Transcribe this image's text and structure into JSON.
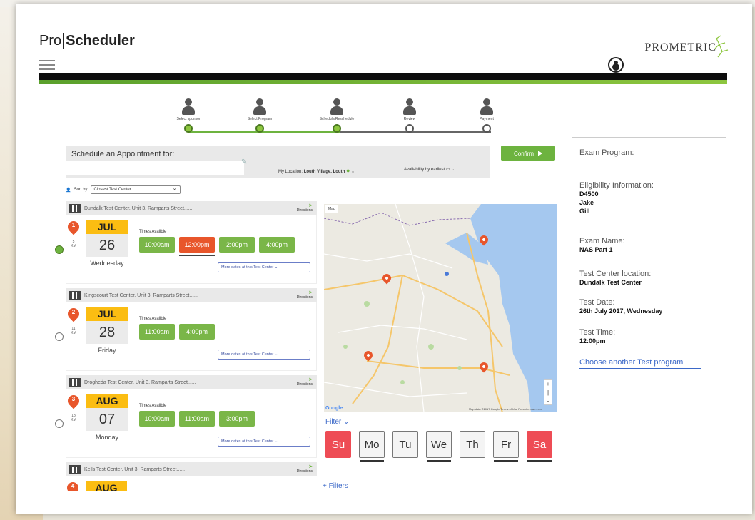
{
  "app": {
    "logo_prefix": "Pro",
    "logo_name": "Scheduler",
    "brand": "PROMETRIC"
  },
  "steps": [
    {
      "label": "Select sponsor",
      "done": true
    },
    {
      "label": "Select Program",
      "done": true
    },
    {
      "label": "Schedule/Reschedule",
      "done": true
    },
    {
      "label": "Review",
      "done": false
    },
    {
      "label": "Payment",
      "done": false
    }
  ],
  "schedule": {
    "title": "Schedule an Appointment for:",
    "location_prefix": "My Location:",
    "location": "Louth Village, Louth",
    "availability": "Availability by earliest",
    "confirm_label": "Confirm"
  },
  "sort": {
    "label": "Sort by",
    "value": "Closest Test Center"
  },
  "centers": [
    {
      "name": "Dundalk Test Center, Unit 3, Ramparts Street......",
      "num": "1",
      "dist_n": "5",
      "dist_u": "KM",
      "month": "JUL",
      "day": "26",
      "weekday": "Wednesday",
      "times": [
        "10:00am",
        "12:00pm",
        "2:00pm",
        "4:00pm"
      ],
      "active_time": 1,
      "selected": true
    },
    {
      "name": "Kingscourt Test Center, Unit 3, Ramparts Street......",
      "num": "2",
      "dist_n": "11",
      "dist_u": "KM",
      "month": "JUL",
      "day": "28",
      "weekday": "Friday",
      "times": [
        "11:00am",
        "4:00pm"
      ],
      "active_time": -1,
      "selected": false
    },
    {
      "name": "Drogheda Test Center, Unit 3, Ramparts Street......",
      "num": "3",
      "dist_n": "18",
      "dist_u": "KM",
      "month": "AUG",
      "day": "07",
      "weekday": "Monday",
      "times": [
        "10:00am",
        "11:00am",
        "3:00pm"
      ],
      "active_time": -1,
      "selected": false
    },
    {
      "name": "Kells Test Center, Unit 3, Ramparts Street......",
      "num": "4",
      "dist_n": "",
      "dist_u": "",
      "month": "AUG",
      "day": "",
      "weekday": "",
      "times": [],
      "active_time": -1,
      "selected": false
    }
  ],
  "card_labels": {
    "directions": "Directions",
    "times_available": "Times Availble",
    "more_dates": "More dates at this Test Center"
  },
  "map": {
    "type_btn": "Map",
    "google": "Google",
    "attrib": "Map data ©2017 Google  Terms of Use  Report a map error"
  },
  "filter": {
    "label": "Filter",
    "more": "+ Filters",
    "days": [
      {
        "label": "Su",
        "red": true,
        "underline": false
      },
      {
        "label": "Mo",
        "red": false,
        "underline": true
      },
      {
        "label": "Tu",
        "red": false,
        "underline": false
      },
      {
        "label": "We",
        "red": false,
        "underline": true
      },
      {
        "label": "Th",
        "red": false,
        "underline": false
      },
      {
        "label": "Fr",
        "red": false,
        "underline": true
      },
      {
        "label": "Sa",
        "red": true,
        "underline": true
      }
    ]
  },
  "summary": {
    "exam_program_label": "Exam Program:",
    "eligibility_label": "Eligibility Information:",
    "eligibility_values": [
      "D4500",
      "Jake",
      "Gill"
    ],
    "exam_name_label": "Exam Name:",
    "exam_name": "NAS Part 1",
    "center_label": "Test Center location:",
    "center": "Dundalk Test Center",
    "date_label": "Test Date:",
    "date": "26th July 2017, Wednesday",
    "time_label": "Test Time:",
    "time": "12:00pm",
    "change_link": "Choose another Test program"
  },
  "colors": {
    "green": "#7ab648",
    "orange": "#e8562b",
    "yellow": "#fbbd12",
    "red_day": "#ee4c55",
    "link": "#3b68c8"
  }
}
